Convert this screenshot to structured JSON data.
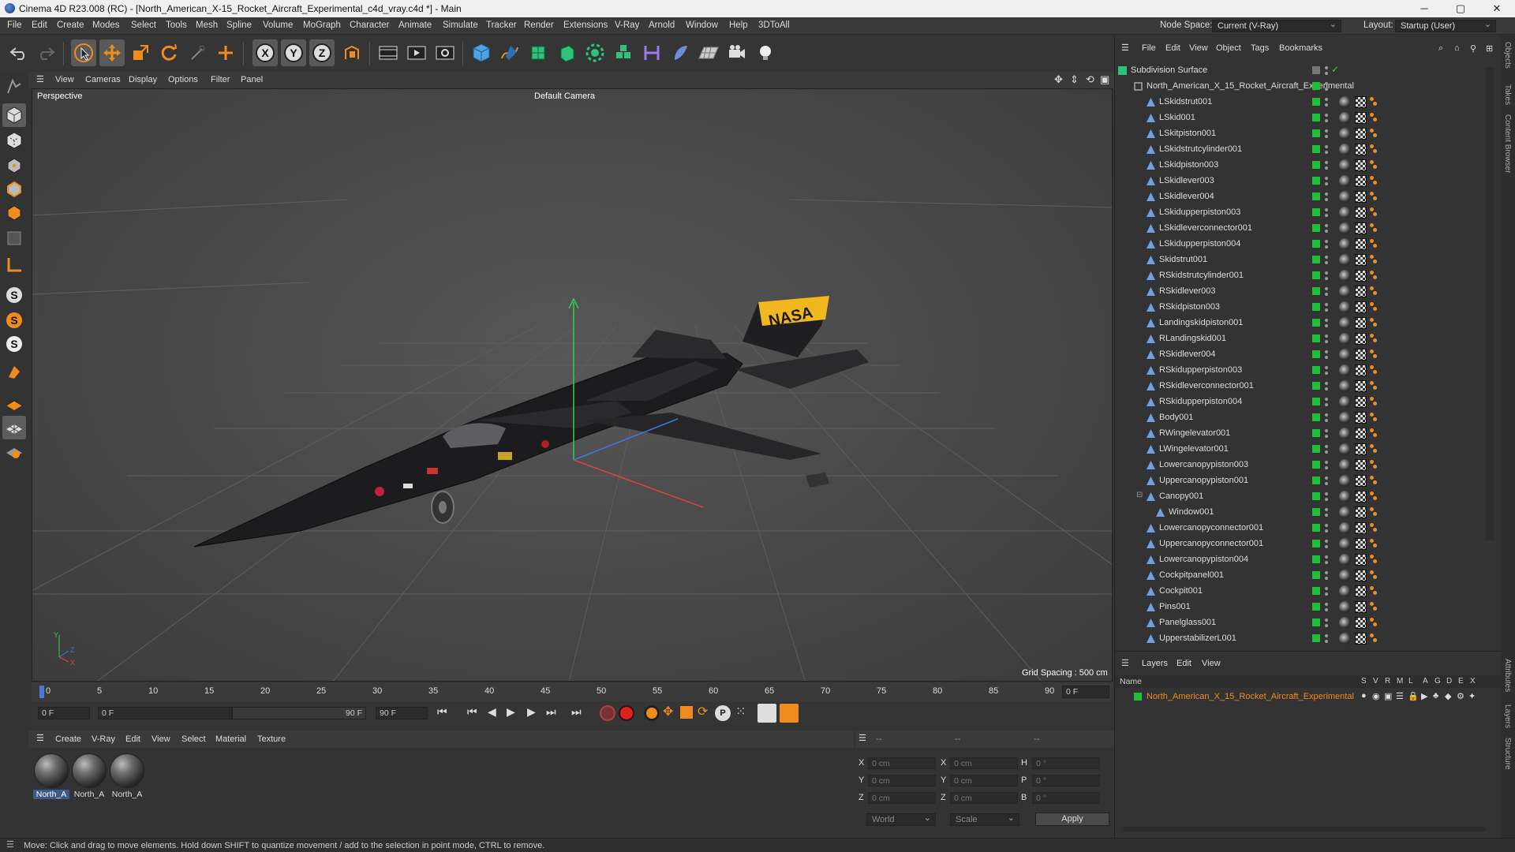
{
  "window": {
    "title": "Cinema 4D R23.008 (RC) - [North_American_X-15_Rocket_Aircraft_Experimental_c4d_vray.c4d *] - Main",
    "minimize": "─",
    "maximize": "▢",
    "close": "✕"
  },
  "menubar": {
    "items": [
      "File",
      "Edit",
      "Create",
      "Modes",
      "Select",
      "Tools",
      "Mesh",
      "Spline",
      "Volume",
      "MoGraph",
      "Character",
      "Animate",
      "Simulate",
      "Tracker",
      "Render",
      "Extensions",
      "V-Ray",
      "Arnold",
      "Window",
      "Help",
      "3DToAll"
    ],
    "node_space_label": "Node Space:",
    "node_space_value": "Current (V-Ray)",
    "layout_label": "Layout:",
    "layout_value": "Startup (User)"
  },
  "viewport": {
    "menu": [
      "View",
      "Cameras",
      "Display",
      "Options",
      "Filter",
      "Panel"
    ],
    "label": "Perspective",
    "camera": "Default Camera",
    "grid_spacing": "Grid Spacing : 500 cm",
    "decal": "NASA",
    "axis_x": "X",
    "axis_y": "Y",
    "axis_z": "Z"
  },
  "timeline": {
    "ticks": [
      "0",
      "5",
      "10",
      "15",
      "20",
      "25",
      "30",
      "35",
      "40",
      "45",
      "50",
      "55",
      "60",
      "65",
      "70",
      "75",
      "80",
      "85",
      "90"
    ],
    "current_frame": "0 F",
    "start_frame": "0 F",
    "range_start": "0 F",
    "range_end": "90 F",
    "end_frame": "90 F"
  },
  "materials": {
    "menu": [
      "Create",
      "V-Ray",
      "Edit",
      "View",
      "Select",
      "Material",
      "Texture"
    ],
    "items": [
      "North_A",
      "North_A",
      "North_A"
    ]
  },
  "coordinates": {
    "col_headers": [
      "--",
      "--",
      "--"
    ],
    "pos": [
      {
        "axis": "X",
        "value": "0 cm"
      },
      {
        "axis": "Y",
        "value": "0 cm"
      },
      {
        "axis": "Z",
        "value": "0 cm"
      }
    ],
    "size": [
      {
        "axis": "X",
        "value": "0 cm"
      },
      {
        "axis": "Y",
        "value": "0 cm"
      },
      {
        "axis": "Z",
        "value": "0 cm"
      }
    ],
    "rot": [
      {
        "axis": "H",
        "value": "0 °"
      },
      {
        "axis": "P",
        "value": "0 °"
      },
      {
        "axis": "B",
        "value": "0 °"
      }
    ],
    "mode": "World",
    "scale": "Scale",
    "apply": "Apply"
  },
  "objects": {
    "menu": [
      "File",
      "Edit",
      "View",
      "Object",
      "Tags",
      "Bookmarks"
    ],
    "root": "Subdivision Surface",
    "group": "North_American_X_15_Rocket_Aircraft_Experimental",
    "items": [
      "LSkidstrut001",
      "LSkid001",
      "LSkitpiston001",
      "LSkidstrutcylinder001",
      "LSkidpiston003",
      "LSkidlever003",
      "LSkidlever004",
      "LSkidupperpiston003",
      "LSkidleverconnector001",
      "LSkidupperpiston004",
      "Skidstrut001",
      "RSkidstrutcylinder001",
      "RSkidlever003",
      "RSkidpiston003",
      "Landingskidpiston001",
      "RLandingskid001",
      "RSkidlever004",
      "RSkidupperpiston003",
      "RSkidleverconnector001",
      "RSkidupperpiston004",
      "Body001",
      "RWingelevator001",
      "LWingelevator001",
      "Lowercanopypiston003",
      "Uppercanopypiston001",
      "Canopy001",
      "Window001",
      "Lowercanopyconnector001",
      "Uppercanopyconnector001",
      "Lowercanopypiston004",
      "Cockpitpanel001",
      "Cockpit001",
      "Pins001",
      "Panelglass001",
      "UpperstabilizerL001"
    ]
  },
  "layers": {
    "menu": [
      "Layers",
      "Edit",
      "View"
    ],
    "columns": [
      "Name",
      "S",
      "V",
      "R",
      "M",
      "L",
      "A",
      "G",
      "D",
      "E",
      "X"
    ],
    "rows": [
      "North_American_X_15_Rocket_Aircraft_Experimental"
    ]
  },
  "right_tabs": [
    "Objects",
    "Takes",
    "Content Browser",
    "Attributes",
    "Layers",
    "Structure"
  ],
  "status": "Move: Click and drag to move elements. Hold down SHIFT to quantize movement / add to the selection in point mode, CTRL to remove.",
  "colors": {
    "accent_orange": "#f08c1e",
    "layer_green": "#1fbf3a",
    "selection_blue": "#3e5a8c",
    "nasa_yellow": "#f0b81e"
  }
}
